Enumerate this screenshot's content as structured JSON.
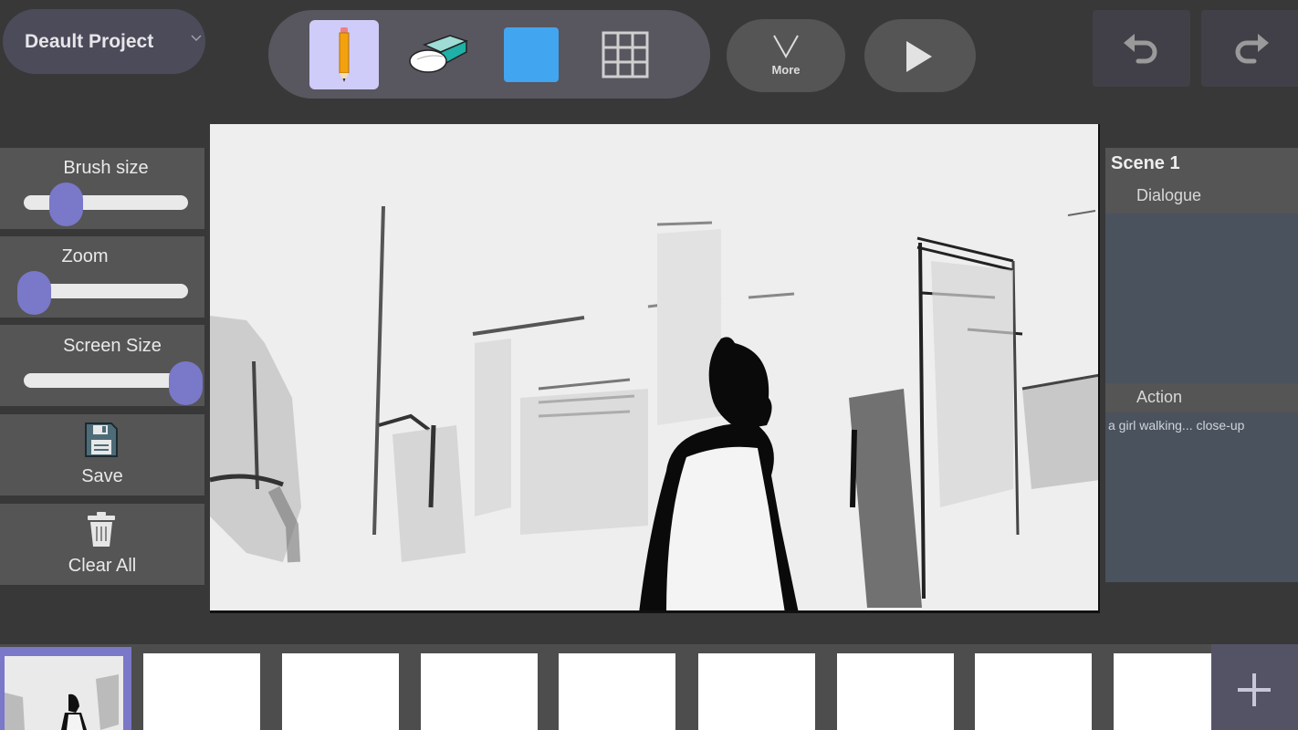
{
  "header": {
    "project_name": "Deault Project",
    "more_label": "More"
  },
  "toolbar": {
    "tools": [
      {
        "name": "pencil",
        "active": true
      },
      {
        "name": "eraser",
        "active": false
      },
      {
        "name": "color",
        "active": false,
        "color": "#42a5f0"
      },
      {
        "name": "grid",
        "active": false
      }
    ]
  },
  "left_panel": {
    "brush_size_label": "Brush size",
    "brush_size_value": 0.25,
    "zoom_label": "Zoom",
    "zoom_value": 0.0,
    "screen_size_label": "Screen Size",
    "screen_size_value": 1.0,
    "save_label": "Save",
    "clear_label": "Clear All"
  },
  "scene": {
    "title": "Scene 1",
    "dialogue_label": "Dialogue",
    "dialogue_text": "",
    "action_label": "Action",
    "action_text": "a girl walking... close-up"
  },
  "filmstrip": {
    "frame_count": 9,
    "selected_index": 0
  },
  "colors": {
    "accent": "#7a78c9",
    "active_tool_bg": "#cfccf9",
    "brush_color": "#42a5f0"
  }
}
